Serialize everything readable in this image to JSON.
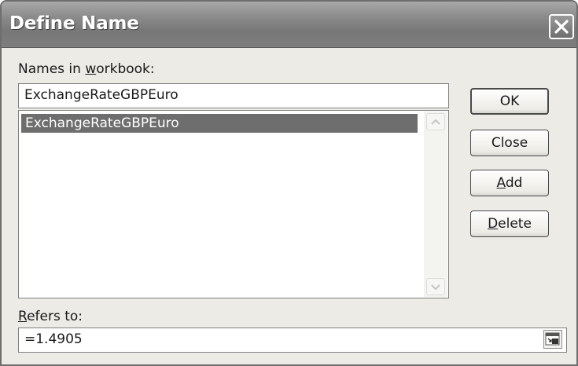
{
  "dialog": {
    "title": "Define Name",
    "close_icon": "close-x-icon"
  },
  "names_label": {
    "prefix": "Names in ",
    "accel": "w",
    "suffix": "orkbook:"
  },
  "name_input": {
    "value": "ExchangeRateGBPEuro"
  },
  "names_list": {
    "items": [
      "ExchangeRateGBPEuro"
    ],
    "selected_index": 0
  },
  "buttons": {
    "ok": "OK",
    "close": "Close",
    "add": {
      "accel": "A",
      "rest": "dd"
    },
    "delete": {
      "accel": "D",
      "rest": "elete"
    }
  },
  "refers_label": {
    "accel": "R",
    "rest": "efers to:"
  },
  "refers_input": {
    "value": "=1.4905"
  },
  "icons": {
    "scroll_up": "chevron-up-icon",
    "scroll_down": "chevron-down-icon",
    "range_picker": "collapse-dialog-icon"
  }
}
